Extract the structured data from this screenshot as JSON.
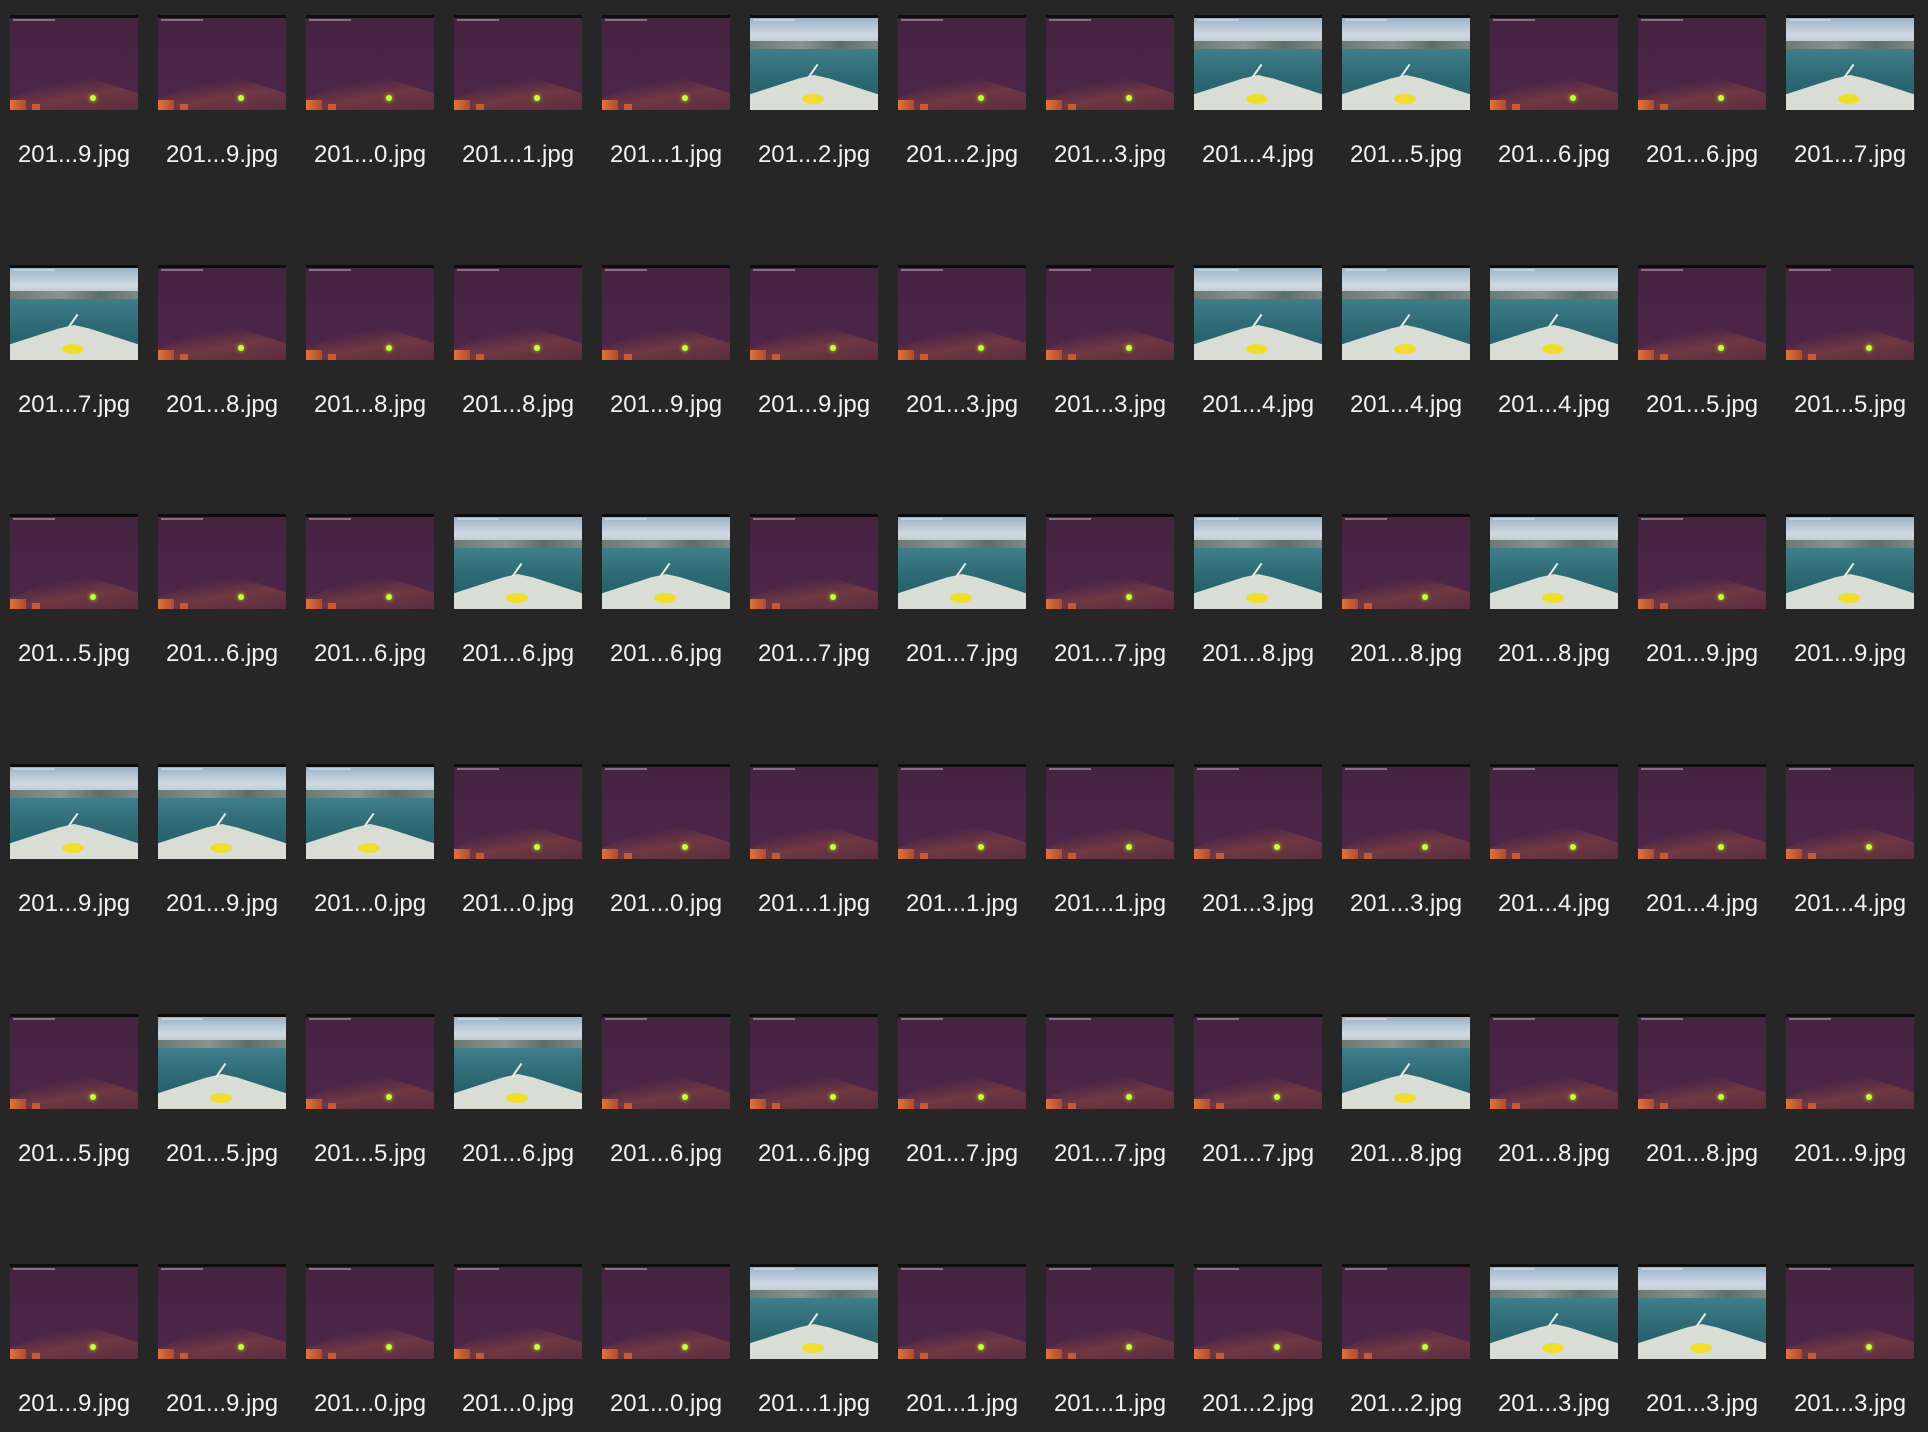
{
  "files": [
    {
      "name": "201...9.jpg",
      "kind": "night"
    },
    {
      "name": "201...9.jpg",
      "kind": "night"
    },
    {
      "name": "201...0.jpg",
      "kind": "night"
    },
    {
      "name": "201...1.jpg",
      "kind": "night"
    },
    {
      "name": "201...1.jpg",
      "kind": "night"
    },
    {
      "name": "201...2.jpg",
      "kind": "day"
    },
    {
      "name": "201...2.jpg",
      "kind": "night"
    },
    {
      "name": "201...3.jpg",
      "kind": "night"
    },
    {
      "name": "201...4.jpg",
      "kind": "day"
    },
    {
      "name": "201...5.jpg",
      "kind": "day"
    },
    {
      "name": "201...6.jpg",
      "kind": "night"
    },
    {
      "name": "201...6.jpg",
      "kind": "night"
    },
    {
      "name": "201...7.jpg",
      "kind": "day"
    },
    {
      "name": "201...7.jpg",
      "kind": "day"
    },
    {
      "name": "201...8.jpg",
      "kind": "night"
    },
    {
      "name": "201...8.jpg",
      "kind": "night"
    },
    {
      "name": "201...8.jpg",
      "kind": "night"
    },
    {
      "name": "201...9.jpg",
      "kind": "night"
    },
    {
      "name": "201...9.jpg",
      "kind": "night"
    },
    {
      "name": "201...3.jpg",
      "kind": "night"
    },
    {
      "name": "201...3.jpg",
      "kind": "night"
    },
    {
      "name": "201...4.jpg",
      "kind": "day"
    },
    {
      "name": "201...4.jpg",
      "kind": "day"
    },
    {
      "name": "201...4.jpg",
      "kind": "day"
    },
    {
      "name": "201...5.jpg",
      "kind": "night"
    },
    {
      "name": "201...5.jpg",
      "kind": "night"
    },
    {
      "name": "201...5.jpg",
      "kind": "night"
    },
    {
      "name": "201...6.jpg",
      "kind": "night"
    },
    {
      "name": "201...6.jpg",
      "kind": "night"
    },
    {
      "name": "201...6.jpg",
      "kind": "day"
    },
    {
      "name": "201...6.jpg",
      "kind": "day"
    },
    {
      "name": "201...7.jpg",
      "kind": "night"
    },
    {
      "name": "201...7.jpg",
      "kind": "day"
    },
    {
      "name": "201...7.jpg",
      "kind": "night"
    },
    {
      "name": "201...8.jpg",
      "kind": "day"
    },
    {
      "name": "201...8.jpg",
      "kind": "night"
    },
    {
      "name": "201...8.jpg",
      "kind": "day"
    },
    {
      "name": "201...9.jpg",
      "kind": "night"
    },
    {
      "name": "201...9.jpg",
      "kind": "day"
    },
    {
      "name": "201...9.jpg",
      "kind": "day"
    },
    {
      "name": "201...9.jpg",
      "kind": "day"
    },
    {
      "name": "201...0.jpg",
      "kind": "day"
    },
    {
      "name": "201...0.jpg",
      "kind": "night"
    },
    {
      "name": "201...0.jpg",
      "kind": "night"
    },
    {
      "name": "201...1.jpg",
      "kind": "night"
    },
    {
      "name": "201...1.jpg",
      "kind": "night"
    },
    {
      "name": "201...1.jpg",
      "kind": "night"
    },
    {
      "name": "201...3.jpg",
      "kind": "night"
    },
    {
      "name": "201...3.jpg",
      "kind": "night"
    },
    {
      "name": "201...4.jpg",
      "kind": "night"
    },
    {
      "name": "201...4.jpg",
      "kind": "night"
    },
    {
      "name": "201...4.jpg",
      "kind": "night"
    },
    {
      "name": "201...5.jpg",
      "kind": "night"
    },
    {
      "name": "201...5.jpg",
      "kind": "day"
    },
    {
      "name": "201...5.jpg",
      "kind": "night"
    },
    {
      "name": "201...6.jpg",
      "kind": "day"
    },
    {
      "name": "201...6.jpg",
      "kind": "night"
    },
    {
      "name": "201...6.jpg",
      "kind": "night"
    },
    {
      "name": "201...7.jpg",
      "kind": "night"
    },
    {
      "name": "201...7.jpg",
      "kind": "night"
    },
    {
      "name": "201...7.jpg",
      "kind": "night"
    },
    {
      "name": "201...8.jpg",
      "kind": "day"
    },
    {
      "name": "201...8.jpg",
      "kind": "night"
    },
    {
      "name": "201...8.jpg",
      "kind": "night"
    },
    {
      "name": "201...9.jpg",
      "kind": "night"
    },
    {
      "name": "201...9.jpg",
      "kind": "night"
    },
    {
      "name": "201...9.jpg",
      "kind": "night"
    },
    {
      "name": "201...0.jpg",
      "kind": "night"
    },
    {
      "name": "201...0.jpg",
      "kind": "night"
    },
    {
      "name": "201...0.jpg",
      "kind": "night"
    },
    {
      "name": "201...1.jpg",
      "kind": "day"
    },
    {
      "name": "201...1.jpg",
      "kind": "night"
    },
    {
      "name": "201...1.jpg",
      "kind": "night"
    },
    {
      "name": "201...2.jpg",
      "kind": "night"
    },
    {
      "name": "201...2.jpg",
      "kind": "night"
    },
    {
      "name": "201...3.jpg",
      "kind": "day"
    },
    {
      "name": "201...3.jpg",
      "kind": "day"
    },
    {
      "name": "201...3.jpg",
      "kind": "night"
    }
  ],
  "colors": {
    "background": "#262626",
    "label": "#f2f2f2"
  }
}
